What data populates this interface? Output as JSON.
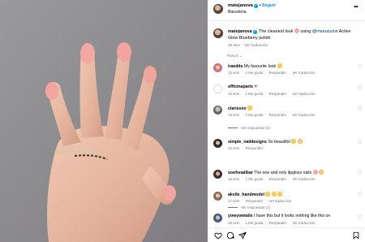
{
  "header": {
    "username": "matejanova",
    "separator": "•",
    "follow_label": "Seguir",
    "location": "Barcelona",
    "more_icon": "more-horizontal-icon"
  },
  "caption": {
    "username": "matejanova",
    "text_before": "The cleanest look",
    "text_middle": "using",
    "mention": "@manucurist",
    "text_after": "Active Glow Blueberry polish",
    "time": "15 sem",
    "translate_label": "Ver traducción"
  },
  "sort_label": "Para ti",
  "comments": [
    {
      "username": "iraedits",
      "text": "My favourite look",
      "time": "15 sem",
      "likes": "1 Me gusta",
      "reply": "Responder",
      "translate": "Ver traducción"
    },
    {
      "username": "officinaparis",
      "text": "",
      "time": "15 sem",
      "likes": "1 Me gusta",
      "reply": "Responder",
      "translate": "Ver traducción"
    },
    {
      "username": "clarisseo",
      "text": "",
      "time": "15 sem",
      "likes": "1 Me gusta",
      "reply": "Responder",
      "translate": "Ver traducción",
      "replies": "Ver respuestas (1)"
    },
    {
      "username": "simple_naildesigns",
      "text": "So beautiful",
      "time": "15 sem",
      "likes": "",
      "reply": "Responder",
      "translate": ""
    },
    {
      "username": "soofsnailbar",
      "text": "The one and only lipgloss nails",
      "time": "15 sem",
      "likes": "1 Me gusta",
      "reply": "Responder",
      "translate": "Ver traducción"
    },
    {
      "username": "akvile_handmodel",
      "text": "",
      "time": "17 sem",
      "likes": "",
      "reply": "Responder",
      "translate": "Ver traducción",
      "replies": "Ver respuestas (1)"
    },
    {
      "username": "yowyowtails",
      "text": "I have this but it looks nothing like this on",
      "time": "15 sem",
      "likes": "1 Me gusta",
      "reply": "Responder",
      "translate": "Ver traducción"
    }
  ],
  "actions": [
    "heart-icon",
    "comment-icon",
    "share-icon",
    "bookmark-icon"
  ],
  "colors": {
    "link": "#0095f6",
    "mention": "#00376b",
    "muted": "#737373",
    "nail": "#f2a5a0"
  }
}
